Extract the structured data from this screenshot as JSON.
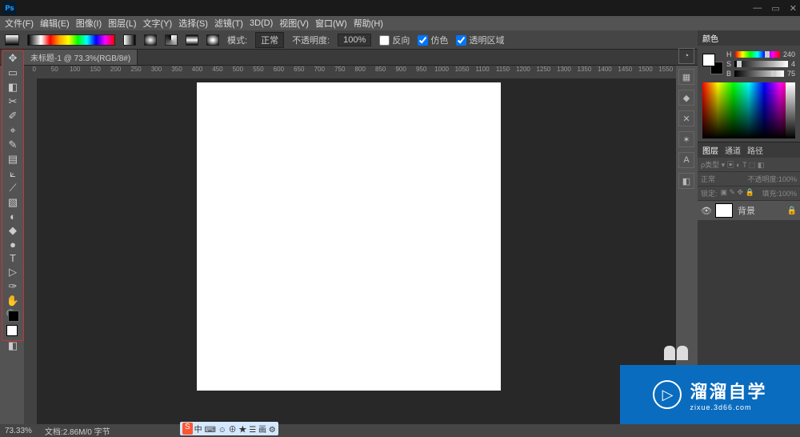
{
  "titlebar": {
    "logo": "Ps"
  },
  "menu": [
    "文件(F)",
    "编辑(E)",
    "图像(I)",
    "图层(L)",
    "文字(Y)",
    "选择(S)",
    "滤镜(T)",
    "3D(D)",
    "视图(V)",
    "窗口(W)",
    "帮助(H)"
  ],
  "options": {
    "mode_label": "模式:",
    "mode_value": "正常",
    "opacity_label": "不透明度:",
    "opacity_value": "100%",
    "cb1": "反向",
    "cb2": "仿色",
    "cb3": "透明区域"
  },
  "tab": {
    "label": "未标题-1 @ 73.3%(RGB/8#)"
  },
  "ruler_marks": [
    "0",
    "50",
    "100",
    "150",
    "200",
    "250",
    "300",
    "350",
    "400",
    "450",
    "500",
    "550",
    "600",
    "650",
    "700",
    "750",
    "800",
    "850",
    "900",
    "950",
    "1000",
    "1050",
    "1100",
    "1150",
    "1200",
    "1250",
    "1300",
    "1350",
    "1400",
    "1450",
    "1500",
    "1550"
  ],
  "tools": [
    "✥",
    "▭",
    "◧",
    "✂",
    "✐",
    "⌖",
    "✎",
    "▤",
    "⟀",
    "⟋",
    "▧",
    "◐",
    "◆",
    "●",
    "◑",
    "✎",
    "⊕",
    "✎",
    "T",
    "▷",
    "✑",
    "✋",
    "🔍"
  ],
  "dock_icons": [
    "◔",
    "▦",
    "◆",
    "✕",
    "✶",
    "A",
    "◧"
  ],
  "color_panel": {
    "tab": "颜色",
    "h": "H",
    "h_val": "240",
    "s": "S",
    "s_val": "4",
    "b": "B",
    "b_val": "75"
  },
  "layers_panel": {
    "tabs": [
      "图层",
      "通道",
      "路径"
    ],
    "kind": "正常",
    "opacity_lbl": "不透明度:",
    "opacity_val": "100%",
    "lock_lbl": "锁定:",
    "fill_lbl": "填充:",
    "fill_val": "100%",
    "layer_name": "背景"
  },
  "status": {
    "zoom": "73.33%",
    "doc": "文档:2.86M/0 字节"
  },
  "watermark": {
    "cn": "溜溜自学",
    "en": "zixue.3d66.com"
  },
  "ime": {
    "s": "S",
    "text": "中 ⌨ ☺ ⊕ ★ ☰ 画 ⚙"
  }
}
